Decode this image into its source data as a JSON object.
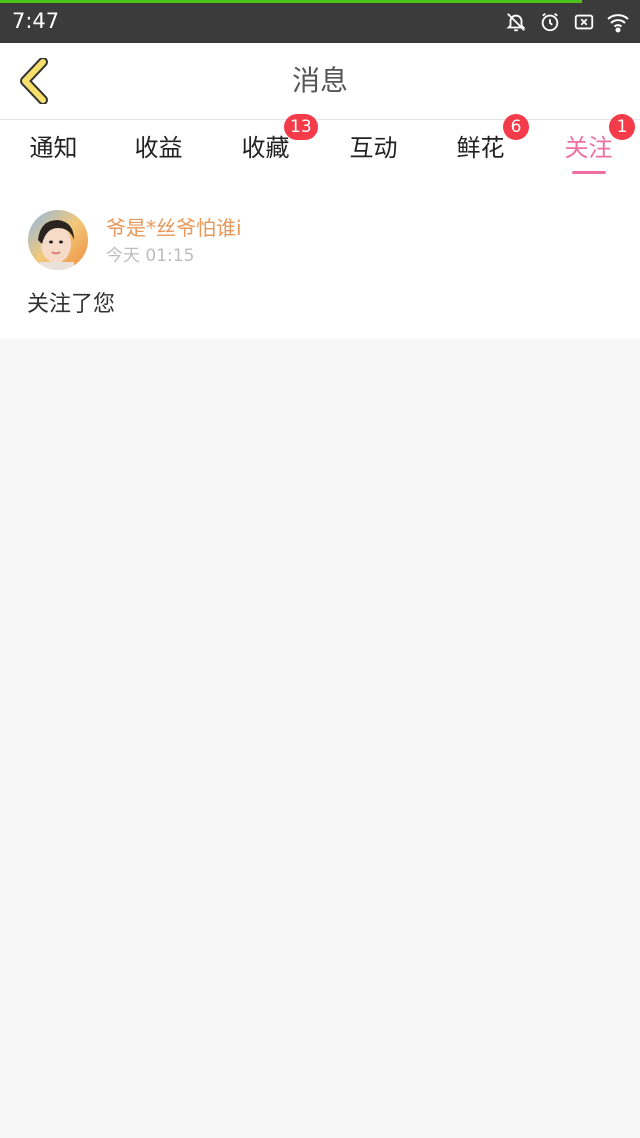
{
  "status_bar": {
    "time": "7:47",
    "progress_fraction": 0.91,
    "progress_color": "#4cc21a",
    "icons": [
      "notifications-off-icon",
      "alarm-icon",
      "screenshot-icon",
      "wifi-icon"
    ]
  },
  "header": {
    "title": "消息",
    "back_icon": "chevron-left-icon",
    "back_color": "#f4e06a"
  },
  "tabs": [
    {
      "label": "通知",
      "badge": ""
    },
    {
      "label": "收益",
      "badge": ""
    },
    {
      "label": "收藏",
      "badge": "13"
    },
    {
      "label": "互动",
      "badge": ""
    },
    {
      "label": "鲜花",
      "badge": "6"
    },
    {
      "label": "关注",
      "badge": "1",
      "active": true
    }
  ],
  "colors": {
    "accent": "#f06fa3",
    "badge": "#f33b4a",
    "username": "#e8995a"
  },
  "item": {
    "username": "爷是*丝爷怕谁i",
    "time": "今天 01:15",
    "message": "关注了您"
  }
}
